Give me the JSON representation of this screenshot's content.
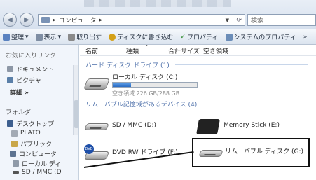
{
  "address_bar": {
    "crumbs": [
      "コンピュータ"
    ],
    "search_placeholder": "検索"
  },
  "toolbar": {
    "items": [
      "整理",
      "表示",
      "取り出す",
      "ディスクに書き込む",
      "プロパティ",
      "システムのプロパティ",
      "»"
    ]
  },
  "nav": {
    "favorites_header": "お気に入りリンク",
    "favorites": [
      "ドキュメント",
      "ピクチャ",
      "詳細 »"
    ],
    "folders_header": "フォルダ",
    "tree": [
      "デスクトップ",
      "PLATO",
      "パブリック",
      "コンピュータ",
      "ローカル ディ",
      "SD / MMC (D"
    ]
  },
  "columns": [
    "名前",
    "種類",
    "合計サイズ",
    "空き領域"
  ],
  "groups": {
    "hdd_title": "ハード ディスク ドライブ (1)",
    "removable_title": "リムーバブル記憶域があるデバイス (4)"
  },
  "drives": {
    "local": {
      "label": "ローカル ディスク (C:)",
      "free_text": "空き領域 226 GB/288 GB",
      "used_fraction": 0.22
    },
    "sd": {
      "label": "SD / MMC (D:)"
    },
    "memstick": {
      "label": "Memory Stick (E:)"
    },
    "dvd": {
      "label": "DVD RW ドライブ (F:)",
      "badge": "DVD"
    },
    "removable": {
      "label": "リムーバブル ディスク (G:)"
    }
  },
  "colors": {
    "group_title": "#4b6ea9",
    "progress": "#2b6cc4"
  }
}
